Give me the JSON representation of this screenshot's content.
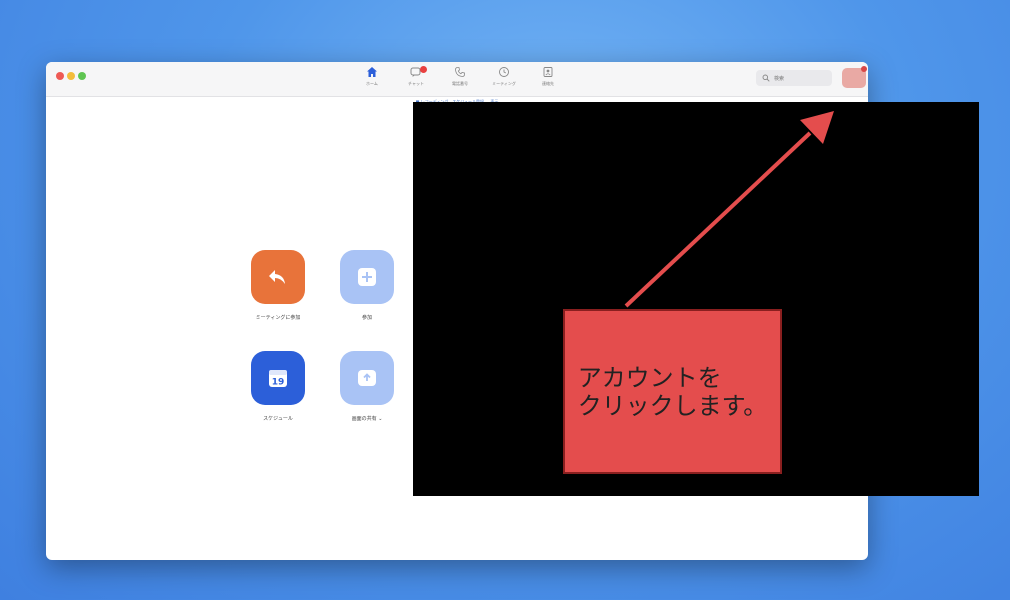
{
  "window": {
    "nav_tabs": [
      {
        "label": "ホーム",
        "icon": "home-icon"
      },
      {
        "label": "チャット",
        "icon": "chat-icon"
      },
      {
        "label": "電話番号",
        "icon": "phone-icon"
      },
      {
        "label": "ミーティング",
        "icon": "clock-icon"
      },
      {
        "label": "連絡先",
        "icon": "contacts-icon"
      }
    ],
    "search": {
      "placeholder": "検索"
    },
    "notice_text": "■ レコーディング...スケジュール登録 ... 表示"
  },
  "actions": [
    {
      "label": "ミーティングに参加",
      "icon": "join-arrow-icon",
      "color": "#e8733a"
    },
    {
      "label": "参加",
      "icon": "plus-icon",
      "color": "#a9c3f5"
    },
    {
      "label": "スケジュール",
      "icon": "calendar-icon",
      "color": "#2c5fd9",
      "calendar_day": "19"
    },
    {
      "label": "画面の共有 ⌄",
      "icon": "share-screen-icon",
      "color": "#a9c3f5"
    }
  ],
  "callout": {
    "text": "アカウントを\nクリックします。"
  },
  "colors": {
    "callout_bg": "#e44d4d",
    "arrow": "#e44d4d",
    "overlay": "#000000"
  }
}
